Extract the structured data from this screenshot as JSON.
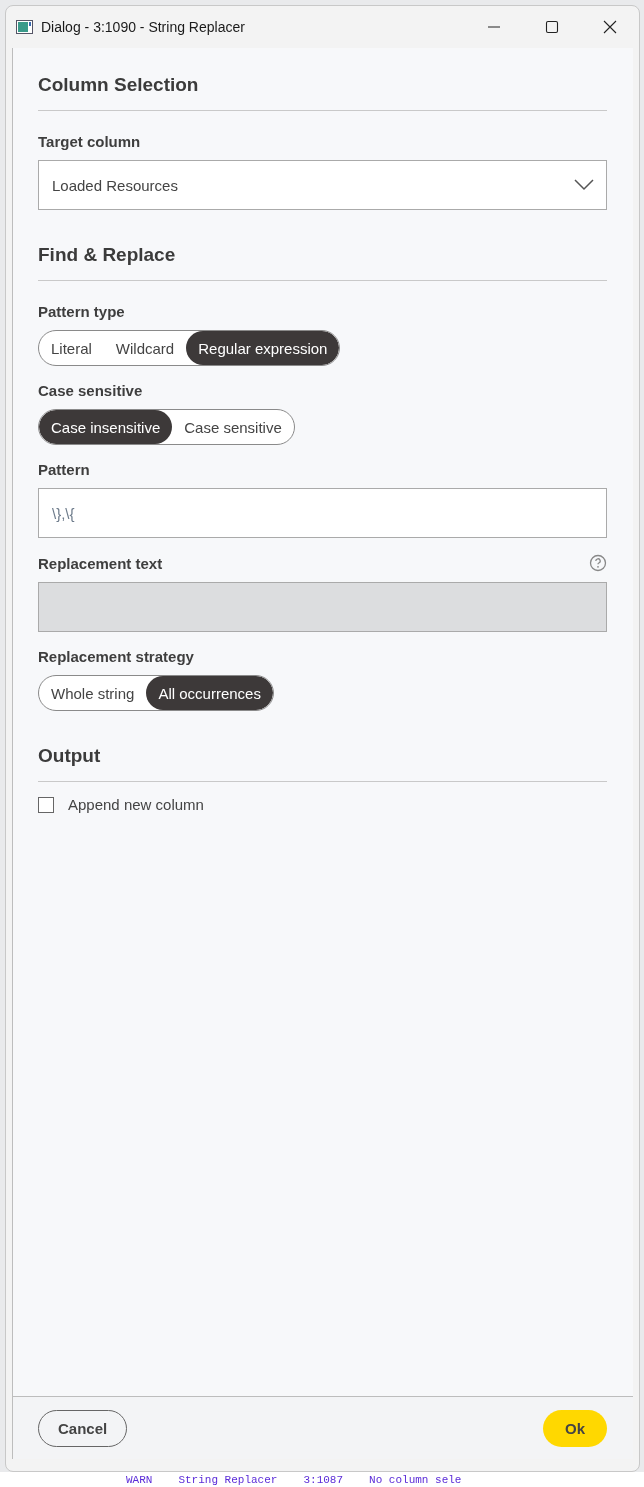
{
  "window": {
    "title": "Dialog - 3:1090 - String Replacer"
  },
  "sections": [
    {
      "title": "Column Selection",
      "fields": [
        {
          "kind": "dropdown",
          "label": "Target column",
          "value": "Loaded Resources"
        }
      ]
    },
    {
      "title": "Find & Replace",
      "fields": [
        {
          "kind": "segmented",
          "label": "Pattern type",
          "options": [
            {
              "label": "Literal",
              "selected": false
            },
            {
              "label": "Wildcard",
              "selected": false
            },
            {
              "label": "Regular expression",
              "selected": true
            }
          ]
        },
        {
          "kind": "segmented",
          "label": "Case sensitive",
          "options": [
            {
              "label": "Case insensitive",
              "selected": true
            },
            {
              "label": "Case sensitive",
              "selected": false
            }
          ]
        },
        {
          "kind": "text",
          "label": "Pattern",
          "value": "\\},\\{",
          "disabled": false
        },
        {
          "kind": "text",
          "label": "Replacement text",
          "disabled": true,
          "help": true
        },
        {
          "kind": "segmented",
          "label": "Replacement strategy",
          "options": [
            {
              "label": "Whole string",
              "selected": false
            },
            {
              "label": "All occurrences",
              "selected": true
            }
          ]
        }
      ]
    },
    {
      "title": "Output",
      "fields": [
        {
          "kind": "checkbox",
          "label": "Append new column",
          "checked": false
        }
      ]
    }
  ],
  "buttons": [
    {
      "label": "Cancel",
      "kind": "secondary"
    },
    {
      "label": "Ok",
      "kind": "primary"
    }
  ],
  "background_log": {
    "level": "WARN",
    "node": "String Replacer",
    "id": "3:1087",
    "message": "No column sele"
  }
}
